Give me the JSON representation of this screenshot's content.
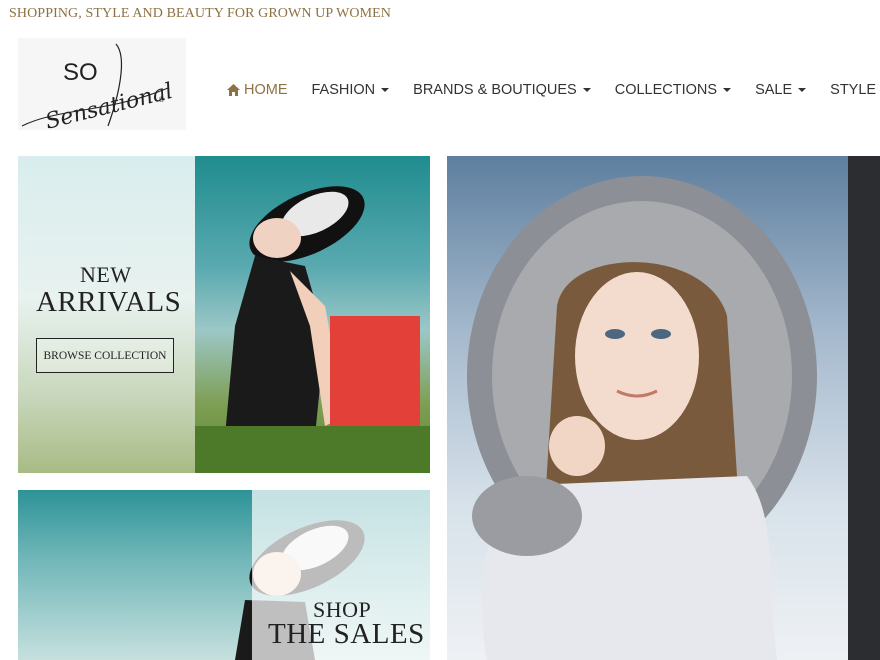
{
  "header": {
    "tagline": "SHOPPING, STYLE AND BEAUTY FOR GROWN UP WOMEN"
  },
  "logo": {
    "line1": "SO",
    "line2": "Sensational",
    "mark": "®"
  },
  "nav": {
    "items": [
      {
        "label": "HOME",
        "icon": "home-icon",
        "active": true,
        "dropdown": false
      },
      {
        "label": "FASHION",
        "dropdown": true
      },
      {
        "label": "BRANDS & BOUTIQUES",
        "dropdown": true
      },
      {
        "label": "COLLECTIONS",
        "dropdown": true
      },
      {
        "label": "SALE",
        "dropdown": true
      },
      {
        "label": "STYLE & ADVI",
        "dropdown": false
      }
    ]
  },
  "panels": {
    "new_arrivals": {
      "line1": "NEW",
      "line2": "ARRIVALS",
      "button": "BROWSE COLLECTION"
    },
    "sale": {
      "line1": "SHOP",
      "line2": "THE SALES"
    }
  },
  "colors": {
    "accent": "#8d7142",
    "text": "#333333",
    "dark_panel": "#2c2d30"
  }
}
